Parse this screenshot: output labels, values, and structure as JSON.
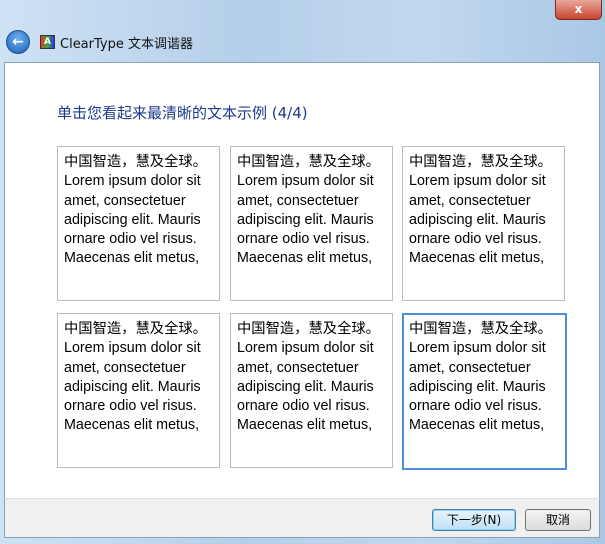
{
  "window": {
    "title": "ClearType 文本调谐器",
    "close_label": "x"
  },
  "heading": "单击您看起来最清晰的文本示例 (4/4)",
  "samples": [
    {
      "text": "中国智造，慧及全球。Lorem ipsum dolor sit amet, consectetuer adipiscing elit. Mauris ornare odio vel risus. Maecenas elit metus,",
      "selected": false
    },
    {
      "text": "中国智造，慧及全球。Lorem ipsum dolor sit amet, consectetuer adipiscing elit. Mauris ornare odio vel risus. Maecenas elit metus,",
      "selected": false
    },
    {
      "text": "中国智造，慧及全球。Lorem ipsum dolor sit amet, consectetuer adipiscing elit. Mauris ornare odio vel risus. Maecenas elit metus,",
      "selected": false
    },
    {
      "text": "中国智造，慧及全球。Lorem ipsum dolor sit amet, consectetuer adipiscing elit. Mauris ornare odio vel risus. Maecenas elit metus,",
      "selected": false
    },
    {
      "text": "中国智造，慧及全球。Lorem ipsum dolor sit amet, consectetuer adipiscing elit. Mauris ornare odio vel risus. Maecenas elit metus,",
      "selected": false
    },
    {
      "text": "中国智造，慧及全球。Lorem ipsum dolor sit amet, consectetuer adipiscing elit. Mauris ornare odio vel risus. Maecenas elit metus,",
      "selected": true
    }
  ],
  "buttons": {
    "next": "下一步(N)",
    "cancel": "取消"
  }
}
